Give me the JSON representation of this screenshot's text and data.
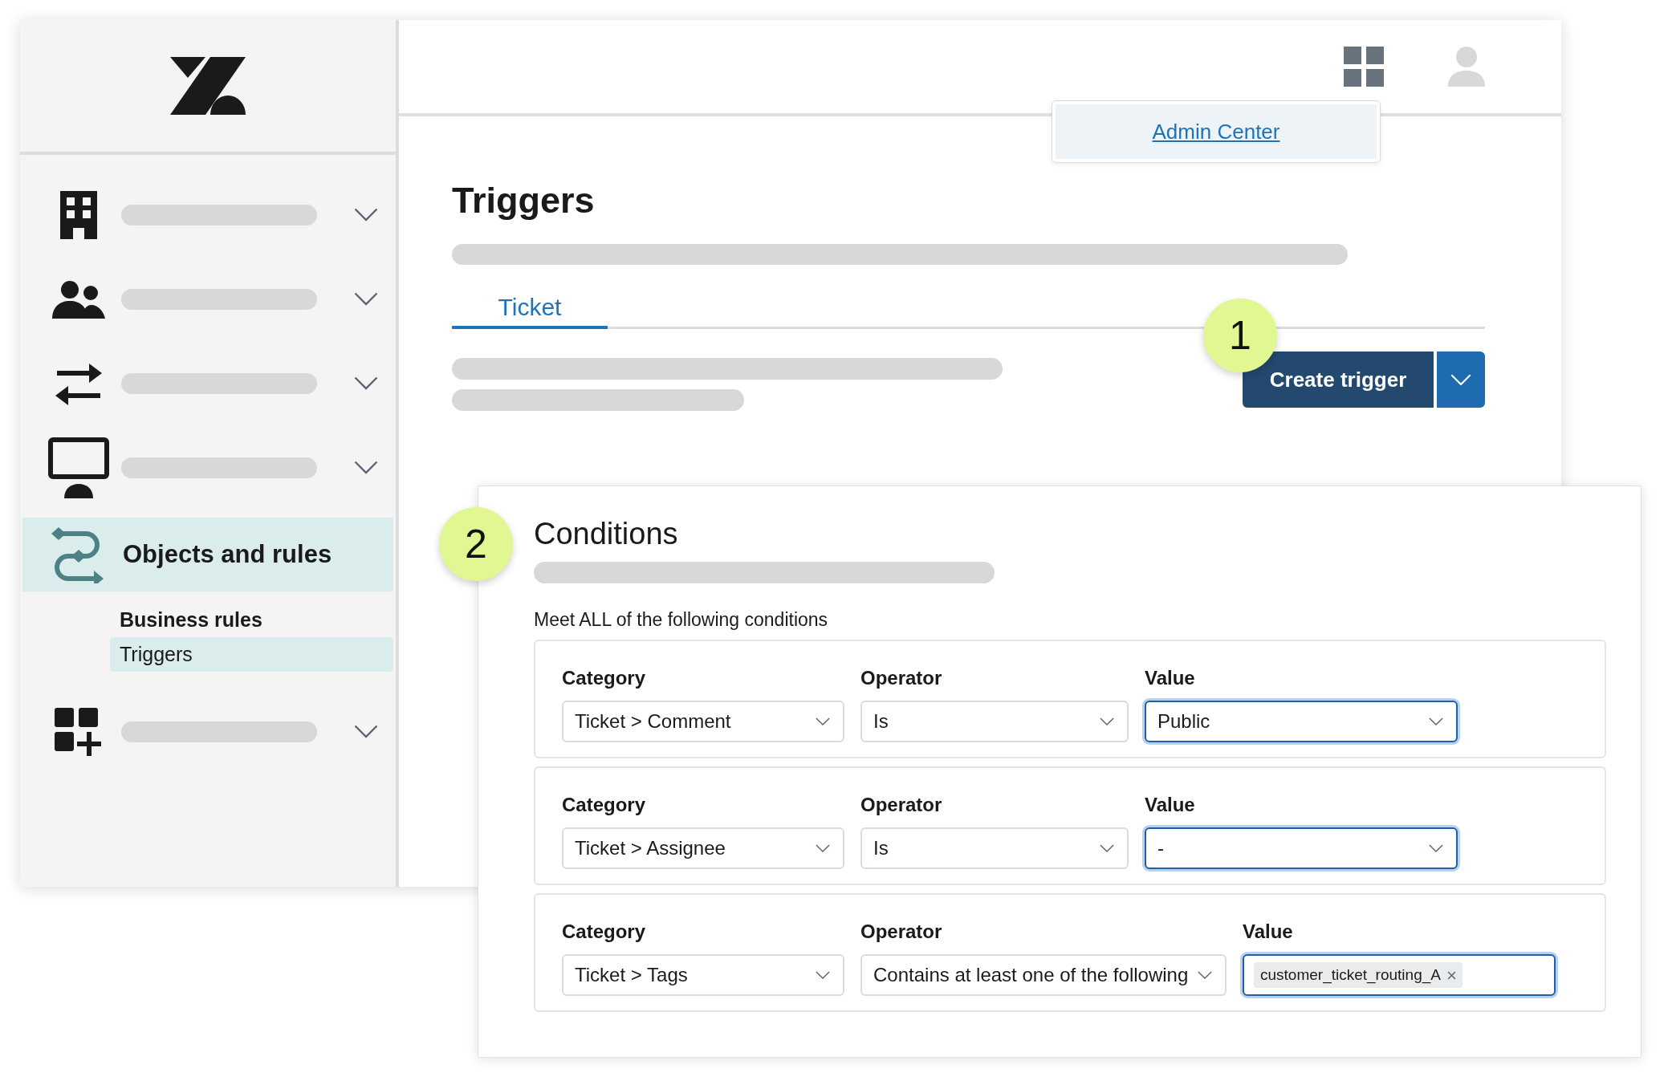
{
  "sidebar": {
    "active_item": {
      "label": "Objects and rules",
      "selected": true,
      "children": [
        {
          "label": "Business rules",
          "selected": false
        },
        {
          "label": "Triggers",
          "selected": true
        }
      ]
    }
  },
  "header": {
    "menu": {
      "link": "Admin Center"
    }
  },
  "page": {
    "title": "Triggers",
    "tabs": [
      {
        "label": "Ticket",
        "selected": true
      }
    ],
    "primary_button": "Create trigger"
  },
  "callouts": [
    "1",
    "2"
  ],
  "conditions": {
    "title": "Conditions",
    "subtitle": "Meet ALL of the following conditions",
    "rows": [
      {
        "fields": [
          {
            "label": "Category",
            "kind": "select",
            "value": "Ticket > Comment",
            "focused": false
          },
          {
            "label": "Operator",
            "kind": "select",
            "value": "Is",
            "focused": false
          },
          {
            "label": "Value",
            "kind": "select",
            "value": "Public",
            "focused": true
          }
        ]
      },
      {
        "fields": [
          {
            "label": "Category",
            "kind": "select",
            "value": "Ticket > Assignee",
            "focused": false
          },
          {
            "label": "Operator",
            "kind": "select",
            "value": "Is",
            "focused": false
          },
          {
            "label": "Value",
            "kind": "select",
            "value": "-",
            "focused": true
          }
        ]
      },
      {
        "fields": [
          {
            "label": "Category",
            "kind": "select",
            "value": "Ticket > Tags",
            "focused": false
          },
          {
            "label": "Operator",
            "kind": "select",
            "value": "Contains at least one of the following",
            "focused": false
          },
          {
            "label": "Value",
            "kind": "tags",
            "tags": [
              "customer_ticket_routing_A"
            ],
            "focused": true
          }
        ]
      }
    ]
  }
}
